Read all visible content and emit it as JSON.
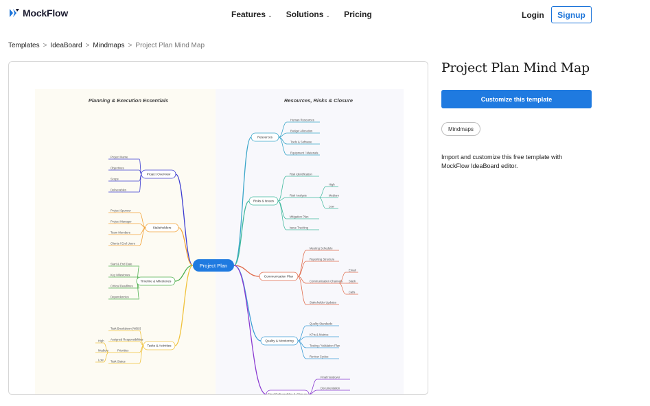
{
  "header": {
    "logo_text": "MockFlow",
    "nav": [
      {
        "label": "Features",
        "has_dropdown": true
      },
      {
        "label": "Solutions",
        "has_dropdown": true
      },
      {
        "label": "Pricing",
        "has_dropdown": false
      }
    ],
    "login_label": "Login",
    "signup_label": "Signup",
    "dropdown_icon": "chevron-down-icon",
    "brand_color": "#1a73d9"
  },
  "breadcrumb": [
    "Templates",
    "IdeaBoard",
    "Mindmaps",
    "Project Plan Mind Map"
  ],
  "breadcrumb_separator": ">",
  "template": {
    "title": "Project Plan Mind Map",
    "cta_label": "Customize this template",
    "tag": "Mindmaps",
    "description": "Import and customize this free template with MockFlow IdeaBoard editor."
  },
  "mindmap": {
    "left_heading": "Planning & Execution Essentials",
    "right_heading": "Resources, Risks & Closure",
    "center": "Project Plan",
    "left_branches": [
      {
        "label": "Project Overview",
        "color": "#3b3bd1",
        "children": [
          "Project Name",
          "Objectives",
          "Scope",
          "Deliverables"
        ]
      },
      {
        "label": "Stakeholders",
        "color": "#f2a33a",
        "children": [
          "Project Sponsor",
          "Project Manager",
          "Team Members",
          "Clients / End Users"
        ]
      },
      {
        "label": "Timeline & Milestones",
        "color": "#4fb04f",
        "children": [
          "Start & End Date",
          "Key Milestones",
          "Critical Deadlines",
          "Dependencies"
        ]
      },
      {
        "label": "Tasks & Activities",
        "color": "#f0c23c",
        "children": [
          "Task Breakdown (WBS)",
          "Assigned Responsibilities",
          "Priorities",
          "Task Status"
        ],
        "sub_children": [
          "High",
          "Medium",
          "Low"
        ]
      }
    ],
    "right_branches": [
      {
        "label": "Resources",
        "color": "#3aa6c9",
        "children": [
          "Human Resources",
          "Budget Allocation",
          "Tools & Software",
          "Equipment / Materials"
        ]
      },
      {
        "label": "Risks & Issues",
        "color": "#3db89c",
        "children": [
          "Risk Identification",
          "Risk Analysis",
          "Mitigation Plan",
          "Issue Tracking"
        ],
        "sub_children": [
          "High",
          "Medium",
          "Low"
        ]
      },
      {
        "label": "Communication Plan",
        "color": "#e06a4a",
        "children": [
          "Meeting Schedule",
          "Reporting Structure",
          "Communication Channels",
          "Stakeholder Updates"
        ],
        "sub_children": [
          "Email",
          "Slack",
          "Calls"
        ]
      },
      {
        "label": "Quality & Monitoring",
        "color": "#3f9ed6",
        "children": [
          "Quality Standards",
          "KPIs & Metrics",
          "Testing / Validation Plan",
          "Review Cycles"
        ]
      },
      {
        "label": "Final Deliverables & Closure",
        "color": "#8a3ad1",
        "children": [
          "Final Handover",
          "Documentation"
        ]
      }
    ],
    "center_color": "#1f7ae0"
  }
}
